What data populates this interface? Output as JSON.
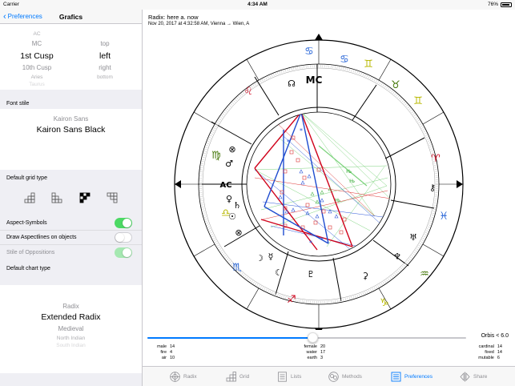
{
  "status": {
    "carrier": "Carrier",
    "time": "4:34 AM",
    "battery": "76%"
  },
  "nav": {
    "back_label": "Preferences",
    "title": "Grafics"
  },
  "angle_picker": {
    "left": [
      "AC",
      "MC",
      "1st Cusp",
      "10th Cusp",
      "Aries",
      "Taurus"
    ],
    "right": [
      "top",
      "left",
      "right",
      "bottom"
    ]
  },
  "font_section": {
    "label": "Font stile",
    "options": [
      "Kairon Sans",
      "Kairon Sans Black"
    ]
  },
  "grid_section": {
    "label": "Default grid type"
  },
  "toggles": [
    {
      "label": "Aspect-Symbols",
      "state": "on"
    },
    {
      "label": "Draw Aspectlines on objects",
      "state": "off"
    },
    {
      "label": "Stile of Oppositions",
      "state": "on-disabled"
    }
  ],
  "chart_type_section": {
    "label": "Default chart type",
    "options": [
      "Radix",
      "Extended Radix",
      "Medieval",
      "North Indian",
      "South Indian"
    ]
  },
  "chart": {
    "title": "Radix: here a. now",
    "subtitle": "Nov 20, 2017 at 4:32:58 AM, Vienna → Wien, A",
    "angle_labels": {
      "mc": "MC",
      "ac": "AC"
    }
  },
  "orbis": {
    "label": "Orbis < 6.0",
    "value": 6.0,
    "fraction": 0.52
  },
  "stats": {
    "col1": [
      [
        "male",
        "14"
      ],
      [
        "fire",
        "4"
      ],
      [
        "air",
        "10"
      ]
    ],
    "col2": [
      [
        "female",
        "20"
      ],
      [
        "water",
        "17"
      ],
      [
        "earth",
        "3"
      ]
    ],
    "col3": [
      [
        "cardinal",
        "14"
      ],
      [
        "fixed",
        "14"
      ],
      [
        "mutable",
        "6"
      ]
    ]
  },
  "tabs": [
    {
      "label": "Radix",
      "icon": "radix-icon",
      "active": false
    },
    {
      "label": "Grid",
      "icon": "grid-icon",
      "active": false
    },
    {
      "label": "Lists",
      "icon": "lists-icon",
      "active": false
    },
    {
      "label": "Methods",
      "icon": "methods-icon",
      "active": false
    },
    {
      "label": "Preferences",
      "icon": "preferences-icon",
      "active": true
    },
    {
      "label": "Share",
      "icon": "share-icon",
      "active": false
    }
  ],
  "colors": {
    "accent": "#007aff",
    "toggle_on": "#4cd964",
    "fire": "#d0021b",
    "earth": "#417505",
    "air": "#b8b800",
    "water": "#1f5fd6"
  }
}
